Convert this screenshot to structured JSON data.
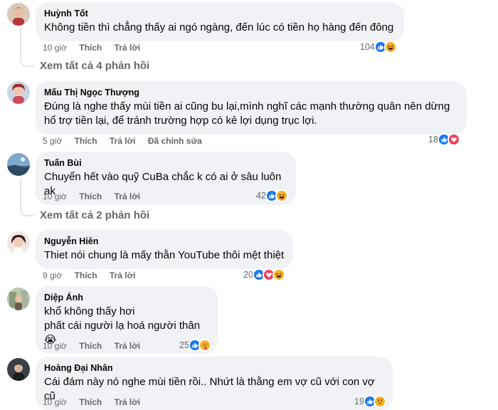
{
  "comments": [
    {
      "author": "Huỳnh Tốt",
      "text": "Không tiền thì chẳng thấy ai ngó ngàng, đến lúc có tiền họ hàng đến đông",
      "time": "10 giờ",
      "like": "Thích",
      "reply": "Trả lời",
      "edited": "",
      "reaction_count": "104",
      "reactions": [
        "like-icon",
        "haha-icon"
      ]
    },
    {
      "author": "Mấu Thị Ngọc Thượng",
      "text": "Đúng là nghe thấy mùi tiền ai cũng bu lại,mình nghĩ các mạnh thường quân nên dừng\nhổ trợ tiền lại, để tránh trường hợp có kẻ lợi dụng trục lợi.",
      "time": "5 giờ",
      "like": "Thích",
      "reply": "Trả lời",
      "edited": "Đã chỉnh sửa",
      "reaction_count": "18",
      "reactions": [
        "like-icon",
        "love-icon"
      ]
    },
    {
      "author": "Tuấn Bùi",
      "text": "Chuyển hết vào quỹ CuBa chắc k có ai ở sâu luôn ak",
      "time": "10 giờ",
      "like": "Thích",
      "reply": "Trả lời",
      "edited": "",
      "reaction_count": "42",
      "reactions": [
        "like-icon",
        "haha-icon"
      ]
    },
    {
      "author": "Nguyễn Hiên",
      "text": "Thiet nói chung là mấy thằn YouTube thôi mệt thiệt",
      "time": "9 giờ",
      "like": "Thích",
      "reply": "Trả lời",
      "edited": "",
      "reaction_count": "20",
      "reactions": [
        "like-icon",
        "love-icon",
        "haha-icon"
      ]
    },
    {
      "author": "Diệp Ánh",
      "text": "khổ không thấy hơi\nphất cái người lạ hoá người thân😭",
      "time": "10 giờ",
      "like": "Thích",
      "reply": "Trả lời",
      "edited": "",
      "reaction_count": "25",
      "reactions": [
        "like-icon",
        "care-icon"
      ]
    },
    {
      "author": "Hoàng Đại Nhân",
      "text": "Cái đám này nó nghe mùi tiền rồi.. Nhứt là thằng em vợ cũ với con vợ cũ",
      "time": "10 giờ",
      "like": "Thích",
      "reply": "Trả lời",
      "edited": "",
      "reaction_count": "19",
      "reactions": [
        "like-icon",
        "sad-icon"
      ]
    }
  ],
  "view_more": [
    "Xem tất cả 4 phản hồi",
    "Xem tất cả 2 phản hồi"
  ],
  "colors": {
    "bubble": "#f0f2f5",
    "meta_text": "#65676b",
    "like_blue": "#1877f2",
    "love_red": "#f33e58",
    "haha_yellow": "#f7b125"
  }
}
